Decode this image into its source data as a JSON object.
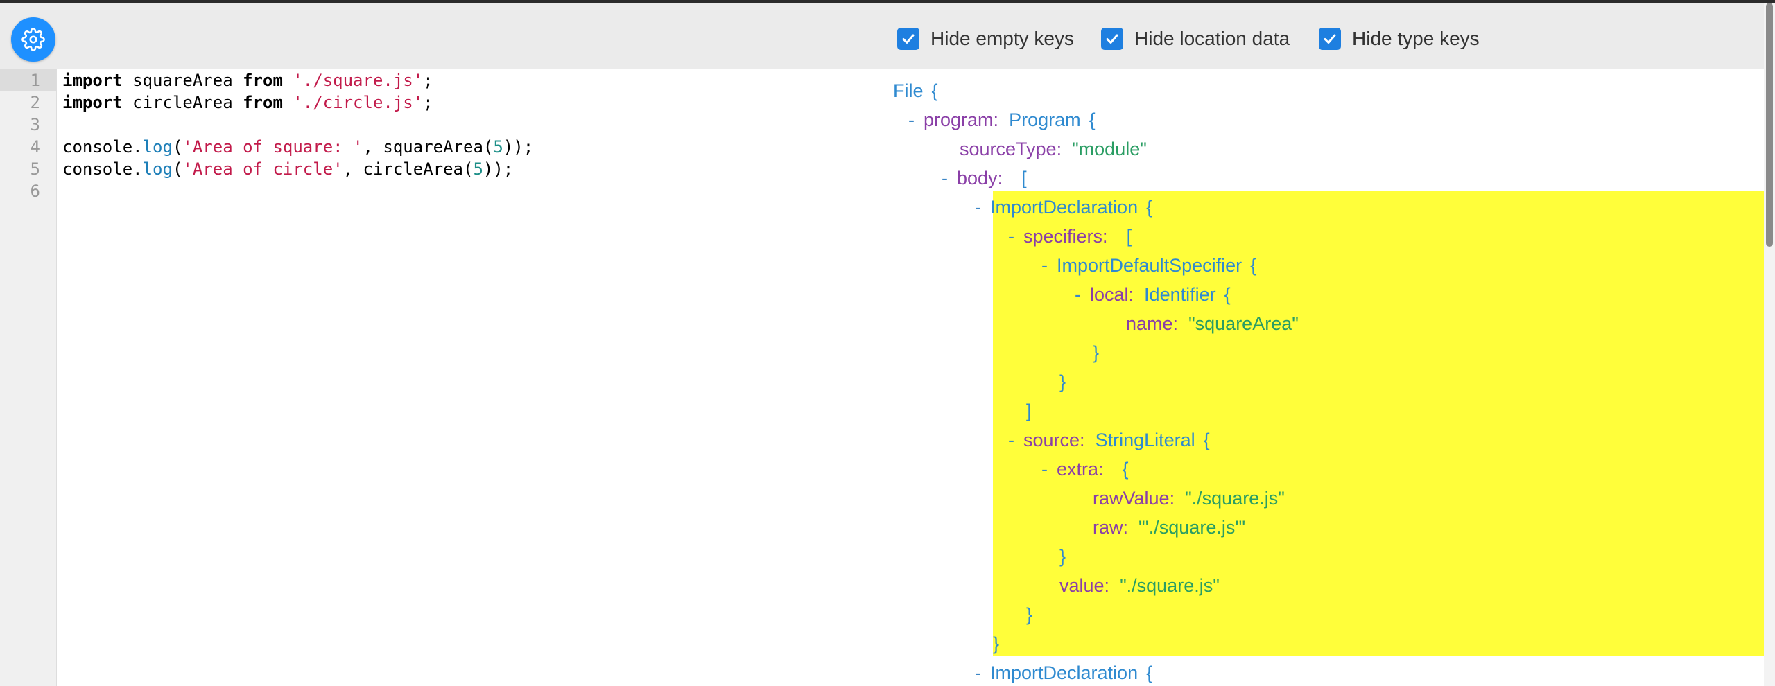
{
  "toolbar": {
    "options": [
      {
        "label": "Hide empty keys",
        "checked": true
      },
      {
        "label": "Hide location data",
        "checked": true
      },
      {
        "label": "Hide type keys",
        "checked": true
      }
    ]
  },
  "editor": {
    "line_numbers": [
      "1",
      "2",
      "3",
      "4",
      "5",
      "6"
    ],
    "lines": [
      [
        {
          "t": "kw",
          "v": "import"
        },
        {
          "t": "plain",
          "v": " squareArea "
        },
        {
          "t": "kw",
          "v": "from"
        },
        {
          "t": "plain",
          "v": " "
        },
        {
          "t": "str",
          "v": "'./square.js'"
        },
        {
          "t": "plain",
          "v": ";"
        }
      ],
      [
        {
          "t": "kw",
          "v": "import"
        },
        {
          "t": "plain",
          "v": " circleArea "
        },
        {
          "t": "kw",
          "v": "from"
        },
        {
          "t": "plain",
          "v": " "
        },
        {
          "t": "str",
          "v": "'./circle.js'"
        },
        {
          "t": "plain",
          "v": ";"
        }
      ],
      [],
      [
        {
          "t": "plain",
          "v": "console."
        },
        {
          "t": "fn",
          "v": "log"
        },
        {
          "t": "plain",
          "v": "("
        },
        {
          "t": "str",
          "v": "'Area of square: '"
        },
        {
          "t": "plain",
          "v": ", squareArea("
        },
        {
          "t": "num",
          "v": "5"
        },
        {
          "t": "plain",
          "v": "));"
        }
      ],
      [
        {
          "t": "plain",
          "v": "console."
        },
        {
          "t": "fn",
          "v": "log"
        },
        {
          "t": "plain",
          "v": "("
        },
        {
          "t": "str",
          "v": "'Area of circle'"
        },
        {
          "t": "plain",
          "v": ", circleArea("
        },
        {
          "t": "num",
          "v": "5"
        },
        {
          "t": "plain",
          "v": "));"
        }
      ],
      []
    ]
  },
  "ast": {
    "nodes": [
      {
        "indent": 0,
        "dash": false,
        "key": "",
        "type": "File",
        "value": "",
        "open": "{"
      },
      {
        "indent": 1,
        "dash": true,
        "key": "program",
        "type": "Program",
        "value": "",
        "open": "{"
      },
      {
        "indent": 2,
        "dash": false,
        "key": "sourceType",
        "type": "",
        "value": "\"module\"",
        "open": ""
      },
      {
        "indent": 2,
        "dash": true,
        "key": "body",
        "type": "",
        "value": "",
        "open": "["
      },
      {
        "indent": 3,
        "dash": true,
        "key": "",
        "type": "ImportDeclaration",
        "value": "",
        "open": "{"
      },
      {
        "indent": 4,
        "dash": true,
        "key": "specifiers",
        "type": "",
        "value": "",
        "open": "["
      },
      {
        "indent": 5,
        "dash": true,
        "key": "",
        "type": "ImportDefaultSpecifier",
        "value": "",
        "open": "{"
      },
      {
        "indent": 6,
        "dash": true,
        "key": "local",
        "type": "Identifier",
        "value": "",
        "open": "{"
      },
      {
        "indent": 7,
        "dash": false,
        "key": "name",
        "type": "",
        "value": "\"squareArea\"",
        "open": ""
      },
      {
        "indent": 6,
        "dash": false,
        "key": "",
        "type": "",
        "value": "",
        "open": "}"
      },
      {
        "indent": 5,
        "dash": false,
        "key": "",
        "type": "",
        "value": "",
        "open": "}"
      },
      {
        "indent": 4,
        "dash": false,
        "key": "",
        "type": "",
        "value": "",
        "open": "]"
      },
      {
        "indent": 4,
        "dash": true,
        "key": "source",
        "type": "StringLiteral",
        "value": "",
        "open": "{"
      },
      {
        "indent": 5,
        "dash": true,
        "key": "extra",
        "type": "",
        "value": "",
        "open": "{"
      },
      {
        "indent": 6,
        "dash": false,
        "key": "rawValue",
        "type": "",
        "value": "\"./square.js\"",
        "open": ""
      },
      {
        "indent": 6,
        "dash": false,
        "key": "raw",
        "type": "",
        "value": "\"'./square.js'\"",
        "open": ""
      },
      {
        "indent": 5,
        "dash": false,
        "key": "",
        "type": "",
        "value": "",
        "open": "}"
      },
      {
        "indent": 5,
        "dash": false,
        "key": "value",
        "type": "",
        "value": "\"./square.js\"",
        "open": ""
      },
      {
        "indent": 4,
        "dash": false,
        "key": "",
        "type": "",
        "value": "",
        "open": "}"
      },
      {
        "indent": 3,
        "dash": false,
        "key": "",
        "type": "",
        "value": "",
        "open": "}"
      },
      {
        "indent": 3,
        "dash": true,
        "key": "",
        "type": "ImportDeclaration",
        "value": "",
        "open": "{"
      }
    ],
    "highlight_color": "#fffe3a"
  },
  "colors": {
    "accent": "#1e90ff",
    "string": "#c21a4a",
    "ast_key": "#8a3fa7",
    "ast_type": "#2f8ad0",
    "ast_value": "#2a9d63"
  },
  "icons": {
    "settings": "gear-icon",
    "checkbox": "checkmark-icon"
  }
}
